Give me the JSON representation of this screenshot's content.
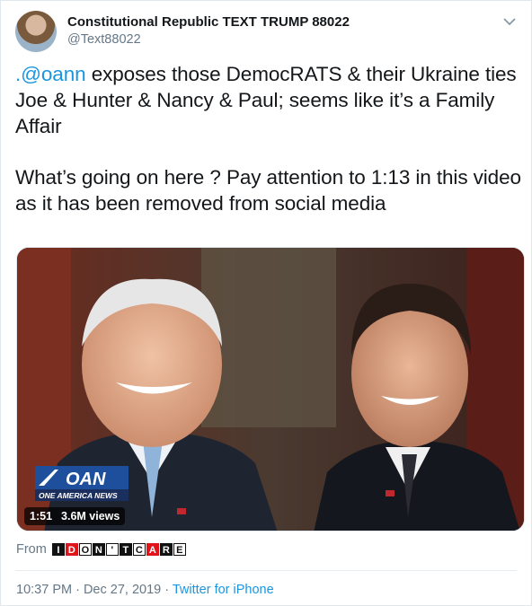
{
  "user": {
    "display_name": "Constitutional Republic TEXT TRUMP 88022",
    "handle": "@Text88022"
  },
  "tweet": {
    "mention": ".@oann",
    "line1_rest": " exposes those DemocRATS & their Ukraine ties Joe & Hunter & Nancy & Paul; seems like it’s a Family Affair",
    "line2": "What’s going on here ? Pay attention to 1:13 in this video as it has been removed from social media"
  },
  "media": {
    "logo_text": "OAN",
    "logo_subtext": "ONE AMERICA NEWS",
    "duration": "1:51",
    "views": "3.6M views"
  },
  "from": {
    "label": "From",
    "source_letters": [
      "I",
      "D",
      "O",
      "N",
      "'",
      "T",
      "C",
      "A",
      "R",
      "E"
    ]
  },
  "meta": {
    "timestamp": "10:37 PM · Dec 27, 2019",
    "separator": " · ",
    "source": "Twitter for iPhone"
  },
  "colors": {
    "link": "#1b95e0",
    "secondary_text": "#657786",
    "primary_text": "#14171a",
    "oan_red": "#e0131b",
    "oan_blue": "#1d4f9c"
  }
}
